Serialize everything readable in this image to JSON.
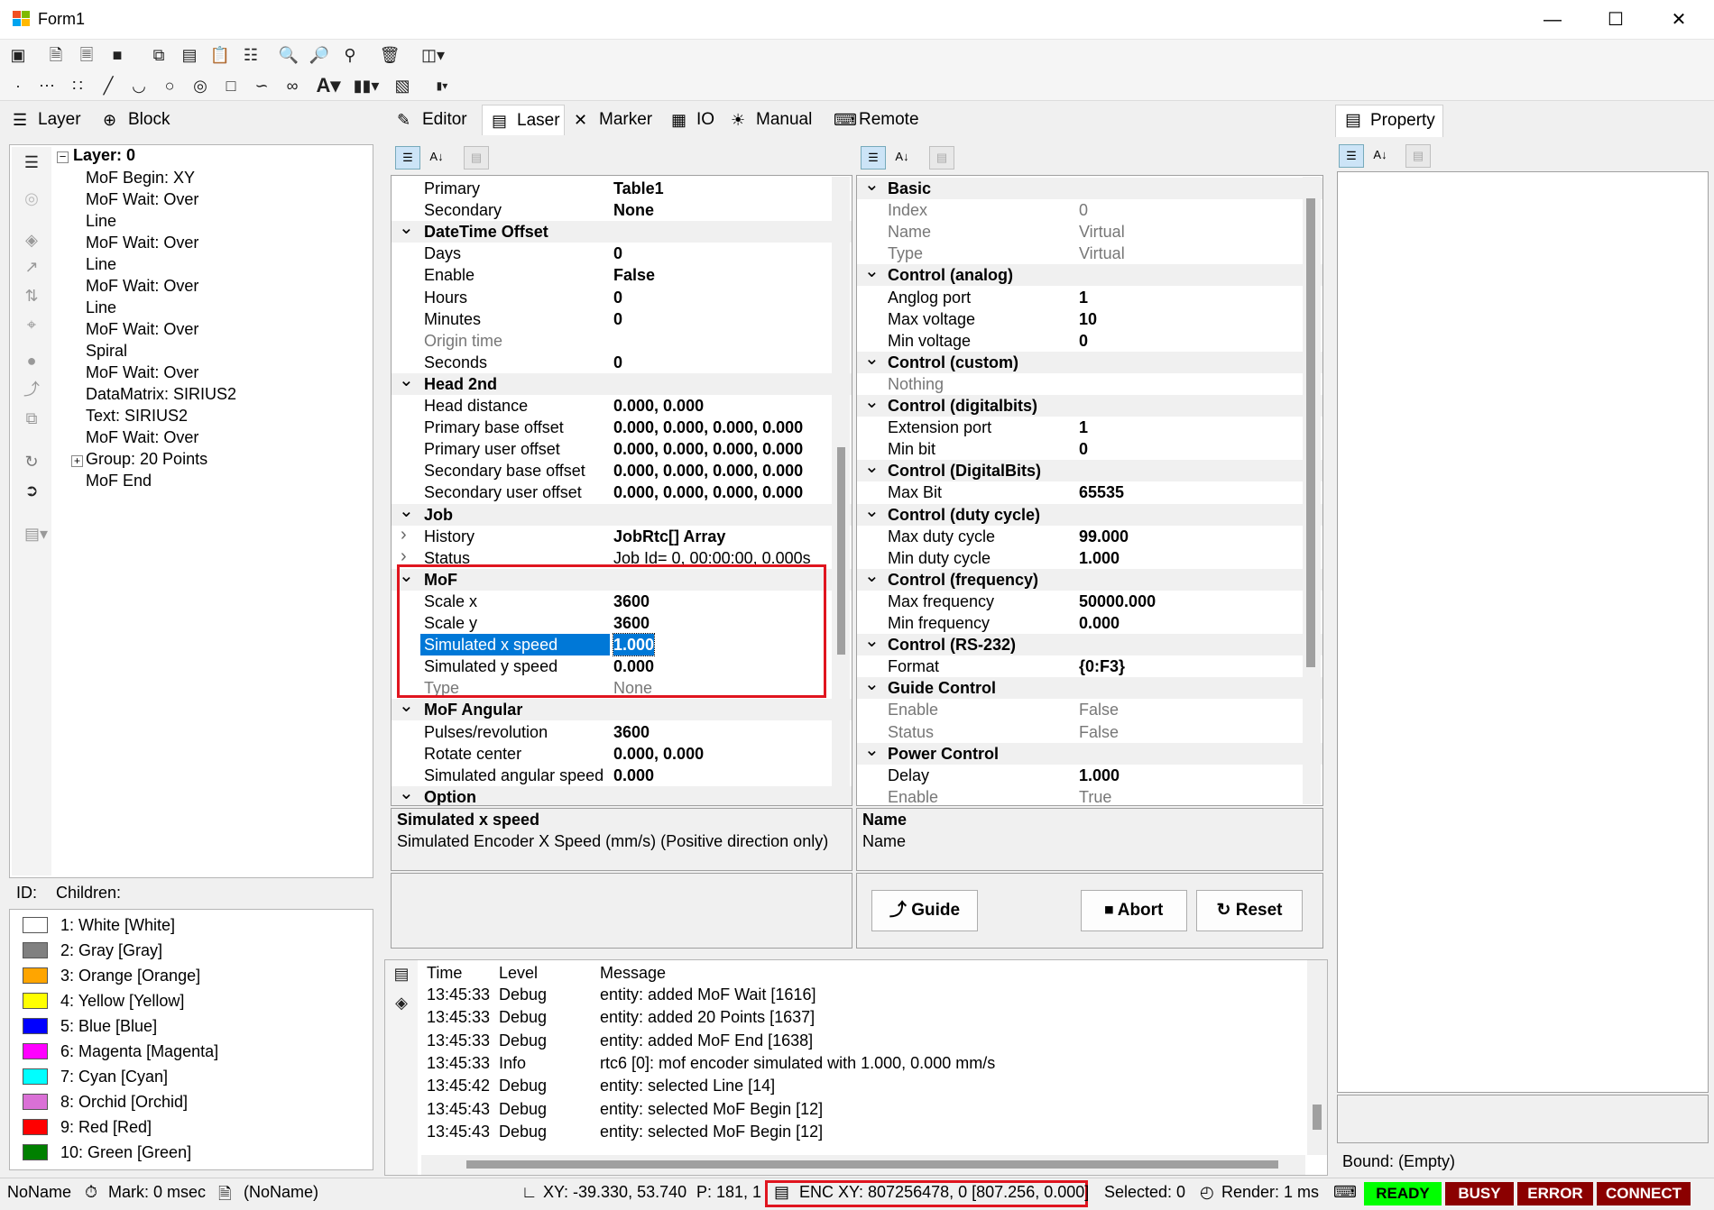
{
  "window": {
    "title": "Form1",
    "minimize": "—",
    "maximize": "☐",
    "close": "✕"
  },
  "toolbar1": {
    "icons": [
      "info-icon",
      "new-file-icon",
      "new-file2-icon",
      "save-icon",
      "copy-icon",
      "copy2-icon",
      "paste-icon",
      "paste2-icon",
      "zoom-out-icon",
      "zoom-in-icon",
      "zoom-fit-icon",
      "delete-icon",
      "layout-icon"
    ]
  },
  "toolbar2": {
    "icons": [
      "point-icon",
      "points-icon",
      "raster-icon",
      "line-icon",
      "arc-icon",
      "circle-icon",
      "ellipse-icon",
      "rectangle-icon",
      "spline-icon",
      "spiral-icon",
      "text-icon",
      "barcode-icon",
      "image-icon",
      "ctrl-icon"
    ]
  },
  "left_tabs": {
    "layer": "Layer",
    "block": "Block"
  },
  "tree": {
    "root": "Layer: 0",
    "nodes": [
      "MoF Begin: XY",
      "MoF Wait: Over",
      "Line",
      "MoF Wait: Over",
      "Line",
      "MoF Wait: Over",
      "Line",
      "MoF Wait: Over",
      "Spiral",
      "MoF Wait: Over",
      "DataMatrix: SIRIUS2",
      "Text: SIRIUS2",
      "MoF Wait: Over",
      "Group: 20 Points",
      "MoF End"
    ]
  },
  "info": {
    "id": "ID:",
    "children": "Children:"
  },
  "legend": [
    {
      "label": "1: White [White]",
      "color": "#ffffff"
    },
    {
      "label": "2: Gray [Gray]",
      "color": "#808080"
    },
    {
      "label": "3: Orange [Orange]",
      "color": "#ffa500"
    },
    {
      "label": "4: Yellow [Yellow]",
      "color": "#ffff00"
    },
    {
      "label": "5: Blue [Blue]",
      "color": "#0000ff"
    },
    {
      "label": "6: Magenta [Magenta]",
      "color": "#ff00ff"
    },
    {
      "label": "7: Cyan [Cyan]",
      "color": "#00ffff"
    },
    {
      "label": "8: Orchid [Orchid]",
      "color": "#da70d6"
    },
    {
      "label": "9: Red [Red]",
      "color": "#ff0000"
    },
    {
      "label": "10: Green [Green]",
      "color": "#008000"
    }
  ],
  "center_tabs": [
    "Editor",
    "Laser",
    "Marker",
    "IO",
    "Manual",
    "Remote"
  ],
  "grid1": [
    {
      "k": "Primary",
      "v": "Table1"
    },
    {
      "k": "Secondary",
      "v": "None"
    },
    {
      "cat": "DateTime Offset"
    },
    {
      "k": "Days",
      "v": "0"
    },
    {
      "k": "Enable",
      "v": "False"
    },
    {
      "k": "Hours",
      "v": "0"
    },
    {
      "k": "Minutes",
      "v": "0"
    },
    {
      "k": "Origin time",
      "v": "",
      "gray": true
    },
    {
      "k": "Seconds",
      "v": "0"
    },
    {
      "cat": "Head 2nd"
    },
    {
      "k": "Head distance",
      "v": "0.000, 0.000"
    },
    {
      "k": "Primary base offset",
      "v": "0.000, 0.000, 0.000, 0.000"
    },
    {
      "k": "Primary user offset",
      "v": "0.000, 0.000, 0.000, 0.000"
    },
    {
      "k": "Secondary base offset",
      "v": "0.000, 0.000, 0.000, 0.000"
    },
    {
      "k": "Secondary user offset",
      "v": "0.000, 0.000, 0.000, 0.000"
    },
    {
      "cat": "Job"
    },
    {
      "k": "History",
      "v": "JobRtc[] Array",
      "exp": true
    },
    {
      "k": "Status",
      "v": "Job Id= 0, 00:00:00, 0.000s",
      "exp": true,
      "normal": true
    },
    {
      "cat": "MoF"
    },
    {
      "k": "Scale x",
      "v": "3600"
    },
    {
      "k": "Scale y",
      "v": "3600"
    },
    {
      "k": "Simulated x speed",
      "v": "1.000",
      "selected": true
    },
    {
      "k": "Simulated y speed",
      "v": "0.000"
    },
    {
      "k": "Type",
      "v": "None",
      "gray": true
    },
    {
      "cat": "MoF Angular"
    },
    {
      "k": "Pulses/revolution",
      "v": "3600"
    },
    {
      "k": "Rotate center",
      "v": "0.000, 0.000"
    },
    {
      "k": "Simulated angular speed",
      "v": "0.000"
    },
    {
      "cat": "Option"
    }
  ],
  "grid2": [
    {
      "cat": "Basic"
    },
    {
      "k": "Index",
      "v": "0",
      "gray": true
    },
    {
      "k": "Name",
      "v": "Virtual",
      "gray": true
    },
    {
      "k": "Type",
      "v": "Virtual",
      "gray": true
    },
    {
      "cat": "Control (analog)"
    },
    {
      "k": "Anglog port",
      "v": "1"
    },
    {
      "k": "Max voltage",
      "v": "10"
    },
    {
      "k": "Min voltage",
      "v": "0"
    },
    {
      "cat": "Control (custom)"
    },
    {
      "k": "Nothing",
      "v": "",
      "gray": true
    },
    {
      "cat": "Control (digitalbits)"
    },
    {
      "k": "Extension port",
      "v": "1"
    },
    {
      "k": "Min bit",
      "v": "0"
    },
    {
      "cat": "Control (DigitalBits)"
    },
    {
      "k": "Max Bit",
      "v": "65535"
    },
    {
      "cat": "Control (duty cycle)"
    },
    {
      "k": "Max duty cycle",
      "v": "99.000"
    },
    {
      "k": "Min duty cycle",
      "v": "1.000"
    },
    {
      "cat": "Control (frequency)"
    },
    {
      "k": "Max frequency",
      "v": "50000.000"
    },
    {
      "k": "Min frequency",
      "v": "0.000"
    },
    {
      "cat": "Control (RS-232)"
    },
    {
      "k": "Format",
      "v": "{0:F3}"
    },
    {
      "cat": "Guide Control"
    },
    {
      "k": "Enable",
      "v": "False",
      "gray": true
    },
    {
      "k": "Status",
      "v": "False",
      "gray": true
    },
    {
      "cat": "Power Control"
    },
    {
      "k": "Delay",
      "v": "1.000"
    },
    {
      "k": "Enable",
      "v": "True",
      "gray": true
    }
  ],
  "desc1": {
    "title": "Simulated x speed",
    "text": "Simulated Encoder X Speed (mm/s) (Positive direction only)"
  },
  "desc2": {
    "title": "Name",
    "text": "Name"
  },
  "buttons": {
    "guide": "Guide",
    "abort": "Abort",
    "reset": "Reset"
  },
  "log": {
    "headers": {
      "time": "Time",
      "level": "Level",
      "message": "Message"
    },
    "rows": [
      {
        "time": "13:45:33",
        "level": "Debug",
        "msg": "entity: added MoF Wait [1616]"
      },
      {
        "time": "13:45:33",
        "level": "Debug",
        "msg": "entity: added 20 Points [1637]"
      },
      {
        "time": "13:45:33",
        "level": "Debug",
        "msg": "entity: added MoF End [1638]"
      },
      {
        "time": "13:45:33",
        "level": "Info",
        "msg": "rtc6 [0]: mof encoder simulated with 1.000, 0.000 mm/s"
      },
      {
        "time": "13:45:42",
        "level": "Debug",
        "msg": "entity: selected Line [14]"
      },
      {
        "time": "13:45:43",
        "level": "Debug",
        "msg": "entity: selected MoF Begin [12]"
      },
      {
        "time": "13:45:43",
        "level": "Debug",
        "msg": "entity: selected MoF Begin [12]"
      }
    ]
  },
  "property": {
    "tab": "Property",
    "bound": "Bound: (Empty)"
  },
  "status": {
    "name": "NoName",
    "mark": "Mark: 0 msec",
    "doc": "(NoName)",
    "xy": "XY: -39.330, 53.740",
    "p": "P: 181, 1",
    "enc": "ENC XY: 807256478, 0 [807.256, 0.000]",
    "selected": "Selected: 0",
    "render": "Render: 1 ms",
    "badges": [
      {
        "label": "READY",
        "color": "#00ff00",
        "text": "#000000"
      },
      {
        "label": "BUSY",
        "color": "#8b0000",
        "text": "#ffffff"
      },
      {
        "label": "ERROR",
        "color": "#8b0000",
        "text": "#ffffff"
      },
      {
        "label": "CONNECT",
        "color": "#8b0000",
        "text": "#ffffff"
      }
    ]
  }
}
